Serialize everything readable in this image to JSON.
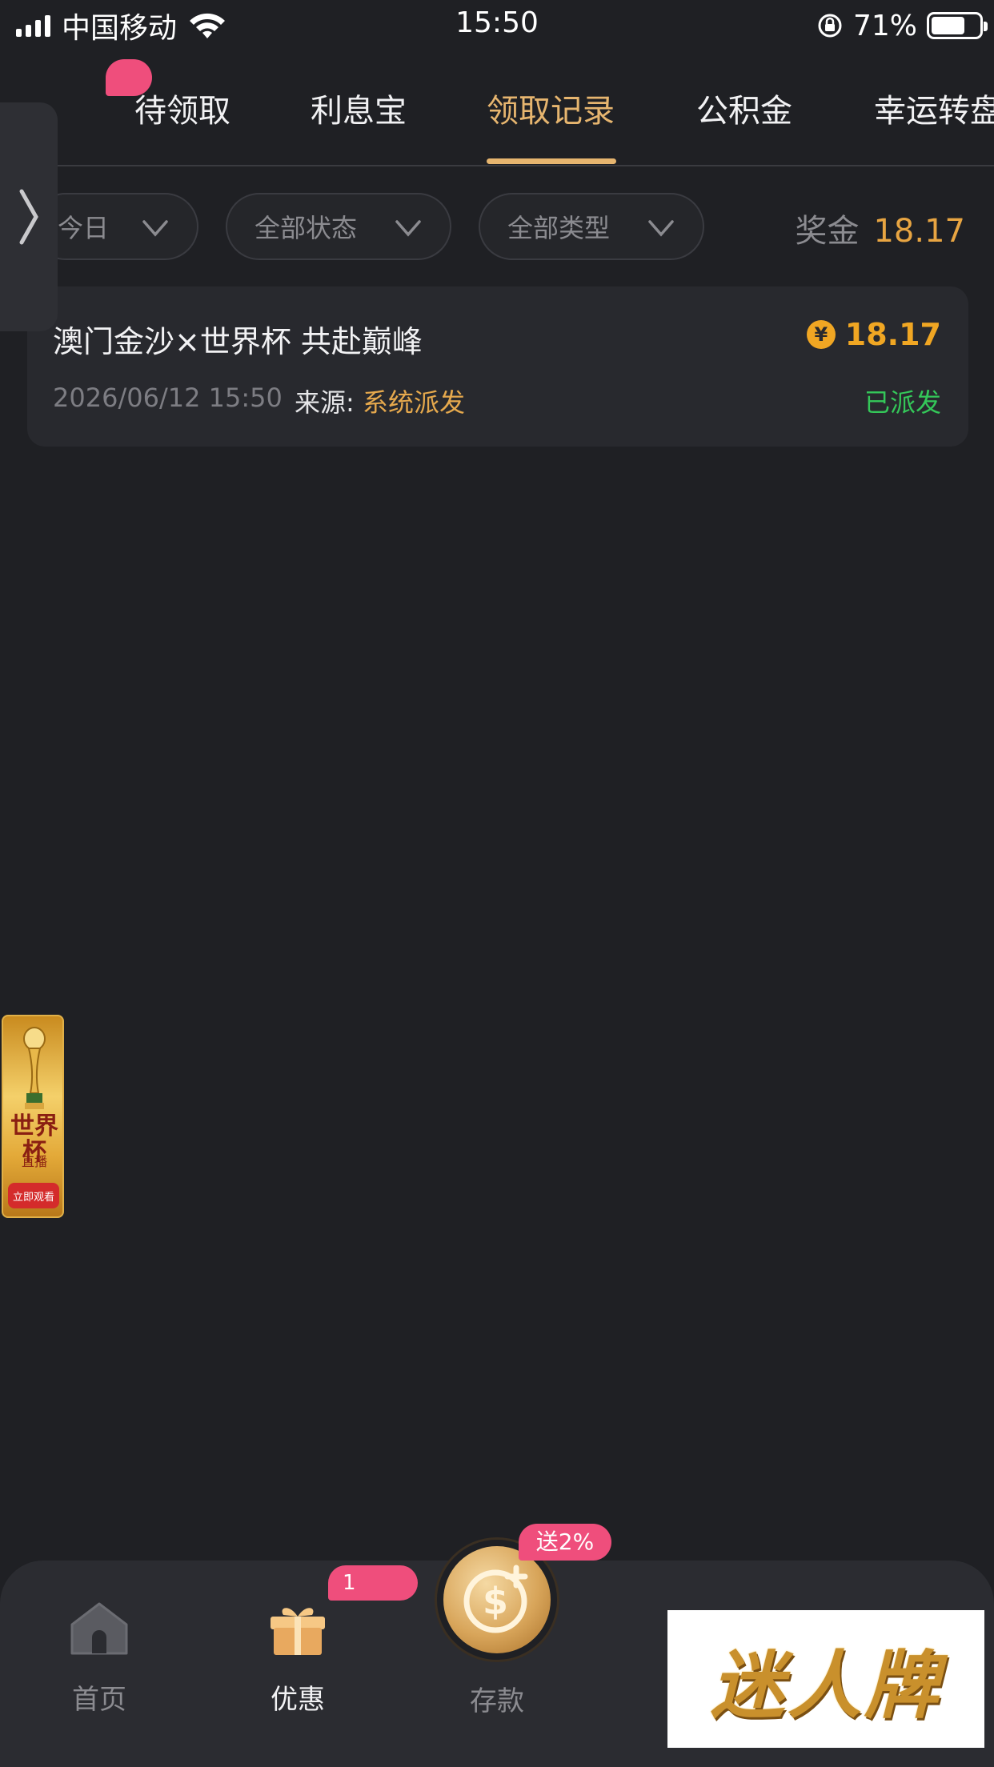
{
  "status_bar": {
    "carrier": "中国移动",
    "time": "15:50",
    "battery": "71%",
    "battery_level": 0.71
  },
  "tabs": [
    {
      "label": "待领取",
      "active": false,
      "has_badge": true
    },
    {
      "label": "利息宝",
      "active": false
    },
    {
      "label": "领取记录",
      "active": true
    },
    {
      "label": "公积金",
      "active": false
    },
    {
      "label": "幸运转盘",
      "active": false
    }
  ],
  "filters": {
    "date": "今日",
    "status": "全部状态",
    "type": "全部类型",
    "bonus_label": "奖金",
    "bonus_value": "18.17"
  },
  "records": [
    {
      "title": "澳门金沙×世界杯 共赴巅峰",
      "currency_icon": "¥",
      "amount": "18.17",
      "datetime": "2026/06/12 15:50",
      "source_label": "来源:",
      "source_value": "系统派发",
      "status": "已派发"
    }
  ],
  "ad_float": {
    "title": "世界杯",
    "subtitle": "直播",
    "button": "立即观看"
  },
  "bottom_nav": {
    "items": [
      {
        "label": "首页",
        "icon": "home-icon",
        "active": false
      },
      {
        "label": "优惠",
        "icon": "gift-icon",
        "active": true,
        "badge": "1"
      },
      {
        "label": "存款",
        "icon": "deposit-coin-icon",
        "active": false,
        "badge": "送2%"
      }
    ]
  },
  "watermark": "迷人牌",
  "colors": {
    "background": "#1f2024",
    "accent_gold": "#e6b56f",
    "amount_orange": "#f0a623",
    "status_green": "#34c759",
    "badge_pink": "#ef4e7c"
  }
}
